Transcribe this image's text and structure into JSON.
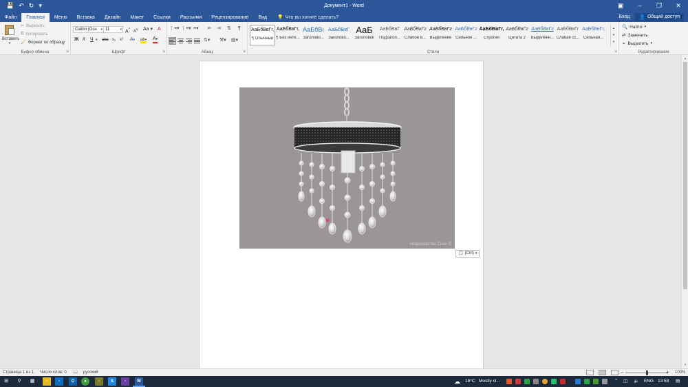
{
  "window": {
    "title": "Документ1 - Word",
    "qat": [
      "save-icon",
      "undo-icon",
      "redo-icon",
      "customize-icon"
    ],
    "controls": [
      "ribbon-options-icon",
      "minimize-icon",
      "restore-icon",
      "close-icon"
    ]
  },
  "tabs": [
    "Файл",
    "Главная",
    "Меню",
    "Вставка",
    "Дизайн",
    "Макет",
    "Ссылки",
    "Рассылки",
    "Рецензирование",
    "Вид"
  ],
  "active_tab": "Главная",
  "tell_me": "Что вы хотите сделать?",
  "account": {
    "signin": "Вход",
    "share": "Общий доступ"
  },
  "clipboard": {
    "paste": "Вставить",
    "cut": "Вырезать",
    "copy": "Копировать",
    "format_painter": "Формат по образцу",
    "label": "Буфер обмена"
  },
  "font": {
    "name": "Calibri (Осн",
    "size": "11",
    "grow": "A",
    "shrink": "A",
    "case": "Aa",
    "clear": "A",
    "bold": "Ж",
    "italic": "К",
    "underline": "Ч",
    "strike": "abc",
    "subscript": "x₂",
    "superscript": "x²",
    "effects": "A",
    "highlight": "ab",
    "color": "A",
    "label": "Шрифт"
  },
  "paragraph": {
    "pilcrow": "¶",
    "label": "Абзац"
  },
  "styles": {
    "items": [
      {
        "sample": "АаБбВвГг,",
        "name": "¶ Обычный"
      },
      {
        "sample": "АаБбВвГг,",
        "name": "¶ Без инте..."
      },
      {
        "sample": "АаБбВı",
        "name": "Заголово..."
      },
      {
        "sample": "АаБбВвГ",
        "name": "Заголово..."
      },
      {
        "sample": "АаБ",
        "name": "Заголовок"
      },
      {
        "sample": "АаБбВвГ",
        "name": "Подзагол..."
      },
      {
        "sample": "АаБбВвГг",
        "name": "Слабое в..."
      },
      {
        "sample": "АаБбВвГг",
        "name": "Выделение"
      },
      {
        "sample": "АаБбВвГг",
        "name": "Сильное ..."
      },
      {
        "sample": "АаБбВвГг,",
        "name": "Строгий"
      },
      {
        "sample": "АаБбВвГг",
        "name": "Цитата 2"
      },
      {
        "sample": "АаБбВвГг",
        "name": "Выделенн..."
      },
      {
        "sample": "АаБбВвГг",
        "name": "Слабая сс..."
      },
      {
        "sample": "АаБбВвГг,",
        "name": "Сильная..."
      }
    ],
    "label": "Стили"
  },
  "editing": {
    "find": "Найти",
    "replace": "Заменить",
    "select": "Выделить",
    "label": "Редактирование"
  },
  "document": {
    "watermark": "«Королевство Сна» ©",
    "paste_options": "(Ctrl)"
  },
  "status": {
    "page": "Страница 1 из 1",
    "words": "Число слов: 0",
    "language": "русский",
    "zoom": "100%",
    "zoom_minus": "−",
    "zoom_plus": "+"
  },
  "taskbar": {
    "weather_temp": "18°C",
    "weather_text": "Mostly cl...",
    "lang": "ENG",
    "time": "13:58"
  },
  "colors": {
    "word_blue": "#2b579a",
    "ribbon_bg": "#f3f3f3",
    "taskbar": "#1c2a3c"
  }
}
